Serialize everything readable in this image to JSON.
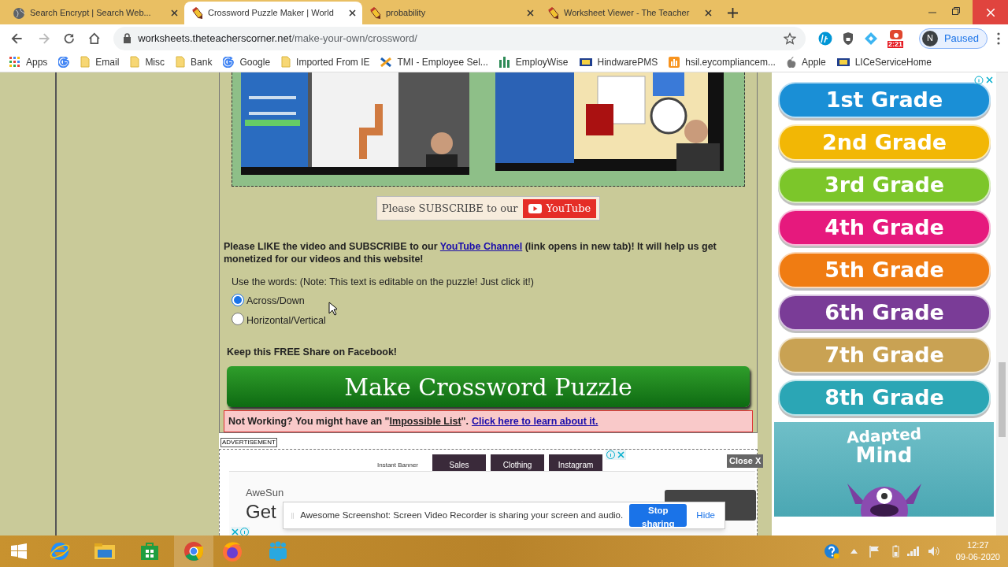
{
  "browser": {
    "tabs": [
      {
        "title": "Search Encrypt | Search Web...",
        "kind": "globe",
        "selected": false
      },
      {
        "title": "Crossword Puzzle Maker | World",
        "kind": "pencil",
        "selected": true
      },
      {
        "title": "probability",
        "kind": "pencil",
        "selected": false
      },
      {
        "title": "Worksheet Viewer - The Teacher",
        "kind": "pencil",
        "selected": false
      }
    ],
    "url": {
      "host": "worksheets.theteacherscorner.net",
      "path": "/make-your-own/crossword/"
    },
    "extension_badge": "2:21",
    "profile": {
      "initial": "N",
      "status": "Paused"
    },
    "bookmarks": [
      {
        "label": "Apps",
        "kind": "apps"
      },
      {
        "kind": "google"
      },
      {
        "label": "Email",
        "kind": "folder"
      },
      {
        "label": "Misc",
        "kind": "folder"
      },
      {
        "label": "Bank",
        "kind": "folder"
      },
      {
        "label": "Google",
        "kind": "google"
      },
      {
        "label": "Imported From IE",
        "kind": "folder"
      },
      {
        "label": "TMI - Employee Sel...",
        "kind": "cross"
      },
      {
        "label": "EmployWise",
        "kind": "bars"
      },
      {
        "label": "HindwarePMS",
        "kind": "logo"
      },
      {
        "label": "hsil.eycompliancem...",
        "kind": "orange"
      },
      {
        "label": "Apple",
        "kind": "apple"
      },
      {
        "label": "LICeServiceHome",
        "kind": "logo"
      }
    ]
  },
  "page": {
    "subscribe": {
      "text": "Please SUBSCRIBE to our",
      "button": "YouTube"
    },
    "like_text": {
      "before": "Please LIKE the video and SUBSCRIBE to our ",
      "link": "YouTube Channel",
      "after": " (link opens in new tab)! It will help us get monetized for our videos and this website!"
    },
    "words": {
      "label": "Use the words: (Note: This text is editable on the puzzle! Just click it!)",
      "options": [
        {
          "label": "Across/Down",
          "selected": true
        },
        {
          "label": "Horizontal/Vertical",
          "selected": false
        }
      ]
    },
    "share_note": "Keep this FREE Share on Facebook!",
    "make_button": "Make Crossword Puzzle",
    "warning": {
      "before": "Not Working? You might have an \"",
      "link1": "Impossible List",
      "middle": "\".",
      "link2": "Click here to learn about it."
    },
    "ad": {
      "label": "ADVERTISEMENT",
      "caption": "Instant Banner",
      "tiles": [
        "Sales",
        "Clothing",
        "Instagram"
      ],
      "brand": "AweSun",
      "headline": "Get",
      "close": "Close X"
    }
  },
  "sidebar": {
    "grades": [
      {
        "label": "1st Grade",
        "color": "#1a8fd6"
      },
      {
        "label": "2nd Grade",
        "color": "#f2b705"
      },
      {
        "label": "3rd Grade",
        "color": "#7cc62a"
      },
      {
        "label": "4th Grade",
        "color": "#e6197d"
      },
      {
        "label": "5th Grade",
        "color": "#f07c12"
      },
      {
        "label": "6th Grade",
        "color": "#7a3c97"
      },
      {
        "label": "7th Grade",
        "color": "#c9a253"
      },
      {
        "label": "8th Grade",
        "color": "#2ba6b5"
      }
    ],
    "promo": {
      "line1": "Adapted",
      "line2": "Mind"
    }
  },
  "notification": {
    "message": "Awesome Screenshot: Screen Video Recorder is sharing your screen and audio.",
    "stop": "Stop sharing",
    "hide": "Hide"
  },
  "taskbar": {
    "time": "12:27",
    "date": "09-06-2020"
  }
}
